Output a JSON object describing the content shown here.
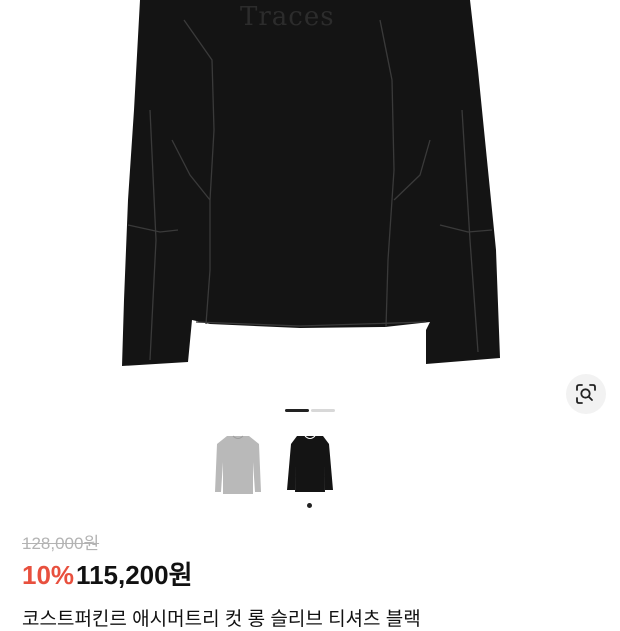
{
  "product": {
    "image_print_text": "Traces",
    "title": "코스트퍼킨르 애시머트리 컷 롱 슬리브 티셔츠 블랙",
    "original_price": "128,000원",
    "discount_rate": "10%",
    "sale_price": "115,200원"
  },
  "gallery": {
    "image_count": 2,
    "current_index": 1,
    "thumbnails": [
      {
        "color": "gray",
        "hex": "#b9b9b9"
      },
      {
        "color": "black",
        "hex": "#141414"
      }
    ]
  },
  "icons": {
    "lens": "lens-search-icon"
  },
  "colors": {
    "discount": "#e8503e",
    "price": "#111111",
    "strikethrough": "#b3b3b3",
    "shirt": "#141414"
  }
}
